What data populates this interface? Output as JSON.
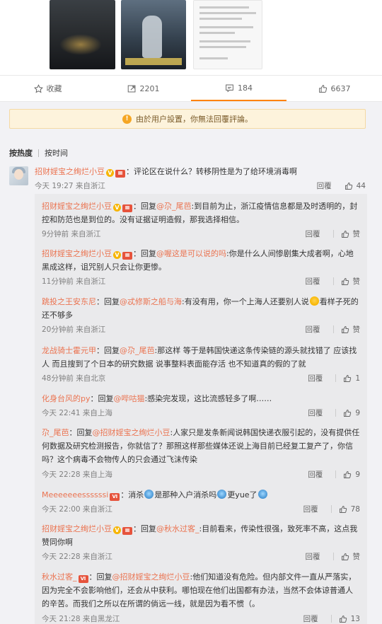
{
  "actions": {
    "favorite": "收藏",
    "repost": "2201",
    "comment": "184",
    "like": "6637"
  },
  "notice": "由於用户設置，你無法回覆評論。",
  "sort": {
    "hot": "按热度",
    "time": "按时间"
  },
  "top_comment": {
    "user": "招财婬宝之绚烂小豆",
    "text": "：评论区在说什么？转移阴性是为了给环境消毒啊",
    "time": "今天 19:27 来自浙江",
    "reply": "回覆",
    "likes": "44"
  },
  "replies": [
    {
      "user": "招财婬宝之绚烂小豆",
      "pre": "：回复",
      "mention": "@尕_尾芭",
      "text": ":到目前为止，浙江疫情信息都是及时透明的，封控和防范也是到位的。没有证据证明造假，那我选择相信。",
      "time": "9分钟前 来自浙江",
      "reply": "回覆",
      "likes": "赞"
    },
    {
      "user": "招财婬宝之绚烂小豆",
      "pre": "：回复",
      "mention": "@喔这是可以说的吗",
      "text": ":你是什么人间惨剧集大成者啊，心地黑成这样，诅咒别人只会让你更惨。",
      "time": "11分钟前 来自浙江",
      "reply": "回覆",
      "likes": "赞"
    },
    {
      "user": "跳投之王安东尼",
      "pre": "：回复",
      "mention": "@忒修斯之船与海",
      "text": ":有没有用，你一个上海人还要别人说",
      "text2": "看样子死的还不够多",
      "time": "20分钟前 来自浙江",
      "reply": "回覆",
      "likes": "赞"
    },
    {
      "user": "龙战骑士霍元甲",
      "pre": "：回复",
      "mention": "@尕_尾芭",
      "text": ":那这样 等于是韩国快递这条传染链的源头就找错了 应该找人 而且搜到了个日本的研究数据 说事整料表面能存活 也不知道真的假的了就",
      "time": "48分钟前 来自北京",
      "reply": "回覆",
      "likes": "1"
    },
    {
      "user": "化身台风的py",
      "pre": "：回复",
      "mention": "@哔咕猫",
      "text": ":感染完发现，这比流感轻多了啊……",
      "time": "今天 22:41 来自上海",
      "reply": "回覆",
      "likes": "9"
    },
    {
      "user": "尕_尾芭",
      "pre": "：回复",
      "mention": "@招财婬宝之绚烂小豆",
      "text": ":人家只是发条新闻说韩国快递衣服引起的，没有提供任何数据及研究检测报告，你就信了？那照这样那些媒体还说上海目前已经复工复产了，你信吗？这个病毒不会物传人的只会通过飞沫传染",
      "time": "今天 22:28 来自上海",
      "reply": "回覆",
      "likes": "9"
    },
    {
      "user": "Meeeeeeessssssi",
      "pre": "：消杀",
      "text": "是那种入户消杀吗",
      "text2": "更yue了",
      "time": "今天 22:00 来自浙江",
      "reply": "回覆",
      "likes": "78"
    },
    {
      "user": "招财婬宝之绚烂小豆",
      "pre": "：回复",
      "mention": "@秋水过客_",
      "text": ":目前看来，传染性很强，致死率不高，这点我赞同你啊",
      "time": "今天 22:28 来自浙江",
      "reply": "回覆",
      "likes": "赞"
    },
    {
      "user": "秋水过客_",
      "pre": "：回复",
      "mention": "@招财婬宝之绚烂小豆",
      "text": ":他们知道没有危险。但内部文件一直从严落实，因为完全不会影响他们，还会从中获利。哪怕现在他们出国都有办法，当然不会体谅普通人的辛苦。而我们之所以在所谓的倘远一线，就是因为看不惯（。",
      "time": "今天 21:28 来自黑龙江",
      "reply": "回覆",
      "likes": "13"
    }
  ]
}
